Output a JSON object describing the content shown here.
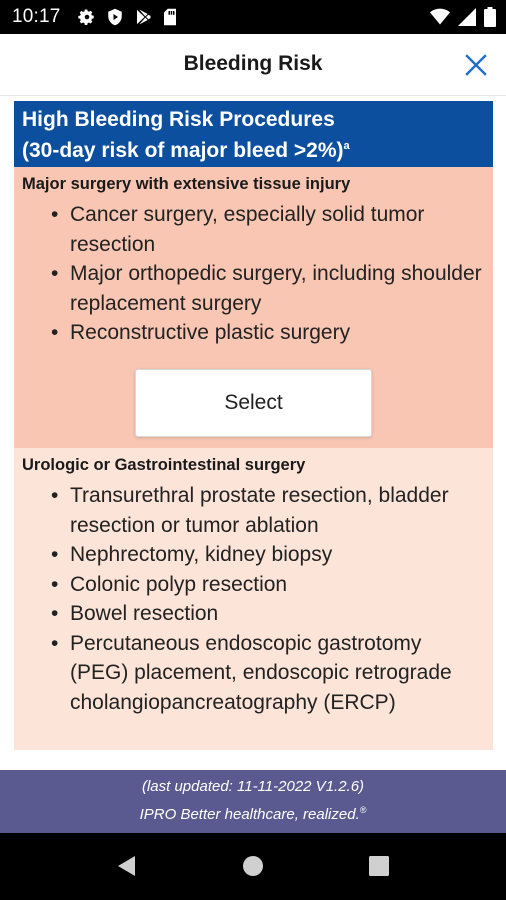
{
  "status_bar": {
    "time": "10:17",
    "left_icons": [
      "gear-icon",
      "shield-play-icon",
      "play-store-icon",
      "sd-card-icon"
    ],
    "right_icons": [
      "wifi-icon",
      "signal-icon",
      "battery-icon"
    ]
  },
  "app_bar": {
    "title": "Bleeding Risk",
    "close_icon": "close-icon",
    "accent_color": "#1f6fd1"
  },
  "section": {
    "title_line1": "High Bleeding Risk Procedures",
    "title_line2": "(30-day risk of major bleed >2%)",
    "superscript": "a",
    "header_color": "#0d4f9f",
    "groups": [
      {
        "title": "Major surgery with extensive tissue injury",
        "color": "#f9c6b3",
        "items": [
          "Cancer surgery, especially solid tumor resection",
          "Major orthopedic surgery, including shoulder replacement surgery",
          "Reconstructive plastic surgery"
        ],
        "select_label": "Select"
      },
      {
        "title": "Urologic or Gastrointestinal surgery",
        "color": "#fde4d9",
        "items": [
          "Transurethral prostate resection, bladder resection or tumor ablation",
          "Nephrectomy, kidney biopsy",
          "Colonic polyp resection",
          "Bowel resection",
          "Percutaneous endoscopic gastrotomy (PEG) placement, endoscopic retrograde cholangiopancreatography (ERCP)"
        ]
      }
    ]
  },
  "footer": {
    "last_updated": "(last updated: 11-11-2022 V1.2.6)",
    "tagline": "IPRO Better healthcare, realized.",
    "tagline_mark": "®",
    "color": "#5a5a91"
  },
  "nav_bar": {
    "icons": [
      "back-icon",
      "home-icon",
      "recents-icon"
    ]
  }
}
